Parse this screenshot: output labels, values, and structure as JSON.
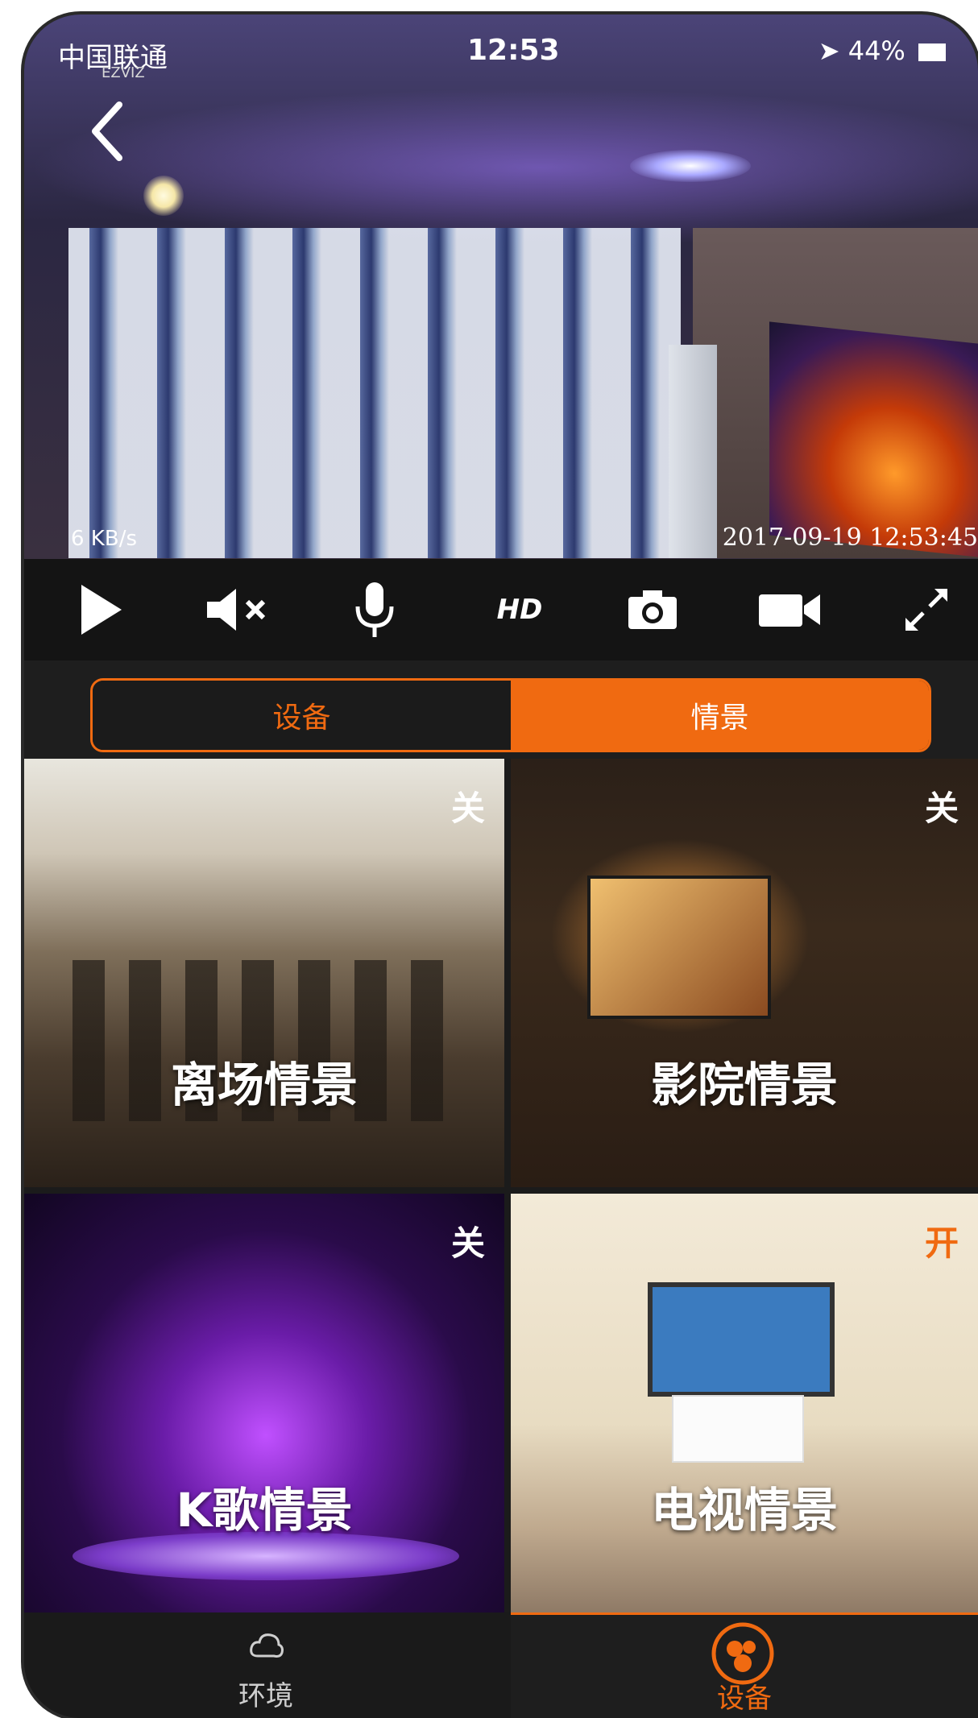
{
  "status_bar": {
    "carrier": "中国联通",
    "carrier_sub": "EZVIZ",
    "time": "12:53",
    "battery": "44%"
  },
  "video": {
    "speed": "6 KB/s",
    "timestamp": "2017-09-19 12:53:45"
  },
  "controls": {
    "hd_label": "HD",
    "icons": [
      "play-icon",
      "mute-icon",
      "microphone-icon",
      "hd-icon",
      "camera-icon",
      "video-record-icon",
      "fullscreen-icon"
    ]
  },
  "tabs": [
    {
      "label": "设备",
      "active": false
    },
    {
      "label": "情景",
      "active": true
    }
  ],
  "scenes": [
    {
      "title": "离场情景",
      "state": "关"
    },
    {
      "title": "影院情景",
      "state": "关"
    },
    {
      "title": "K歌情景",
      "state": "关"
    },
    {
      "title": "电视情景",
      "state": "开"
    }
  ],
  "bottom_nav": [
    {
      "label": "环境",
      "active": false
    },
    {
      "label": "设备",
      "active": true
    }
  ],
  "colors": {
    "accent": "#f06a11",
    "background": "#1b1b1b"
  }
}
